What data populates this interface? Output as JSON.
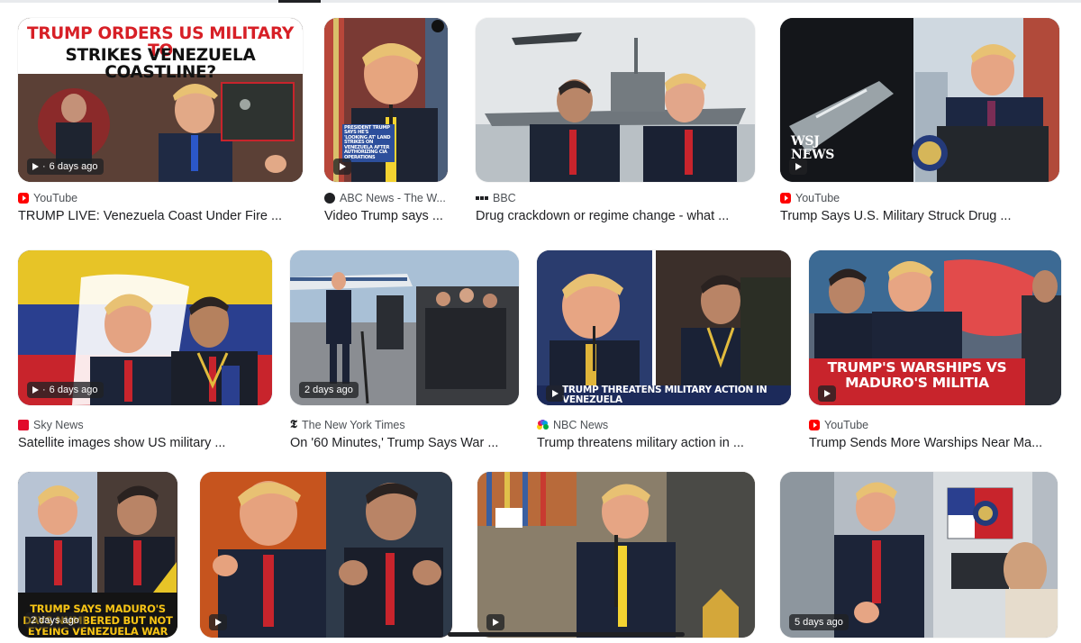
{
  "results": [
    {
      "source": "YouTube",
      "source_icon": "youtube-icon",
      "title": "TRUMP LIVE: Venezuela Coast Under Fire ...",
      "duration": "6 days ago",
      "overlay": "TRUMP ORDERS US MILITARY TO STRIKES VENEZUELA COASTLINE?"
    },
    {
      "source": "ABC News - The W...",
      "source_icon": "abc-news-icon",
      "title": "Video Trump says ...",
      "duration": "",
      "overlay": "PRESIDENT TRUMP SAYS HE'S 'LOOKING AT' LAND STRIKES ON VENEZUELA AFTER AUTHORIZING CIA OPERATIONS"
    },
    {
      "source": "BBC",
      "source_icon": "bbc-icon",
      "title": "Drug crackdown or regime change - what ...",
      "duration": "",
      "overlay": ""
    },
    {
      "source": "YouTube",
      "source_icon": "youtube-icon",
      "title": "Trump Says U.S. Military Struck Drug ...",
      "duration": "",
      "overlay": "WSJ NEWS"
    },
    {
      "source": "Sky News",
      "source_icon": "sky-news-icon",
      "title": "Satellite images show US military ...",
      "duration": "6 days ago",
      "overlay": ""
    },
    {
      "source": "The New York Times",
      "source_icon": "nyt-icon",
      "title": "On '60 Minutes,' Trump Says War ...",
      "duration": "2 days ago",
      "overlay": ""
    },
    {
      "source": "NBC News",
      "source_icon": "nbc-icon",
      "title": "Trump threatens military action in ...",
      "duration": "",
      "overlay": "TRUMP THREATENS MILITARY ACTION IN VENEZUELA"
    },
    {
      "source": "YouTube",
      "source_icon": "youtube-icon",
      "title": "Trump Sends More Warships Near Ma...",
      "duration": "",
      "overlay": "TRUMP'S WARSHIPS VS MADURO'S MILITIA"
    },
    {
      "source": "",
      "source_icon": "",
      "title": "",
      "duration": "2 days ago",
      "overlay": "TRUMP SAYS MADURO'S DAYS NUMBERED BUT NOT EYEING VENEZUELA WAR"
    },
    {
      "source": "",
      "source_icon": "",
      "title": "",
      "duration": "",
      "overlay": ""
    },
    {
      "source": "",
      "source_icon": "",
      "title": "",
      "duration": "",
      "overlay": ""
    },
    {
      "source": "",
      "source_icon": "",
      "title": "",
      "duration": "5 days ago",
      "overlay": ""
    }
  ],
  "badge_prefix": "·",
  "colors": {
    "overlay_red": "#d71f26",
    "overlay_yellow": "#f7c415",
    "badge_bg": "#202124"
  }
}
